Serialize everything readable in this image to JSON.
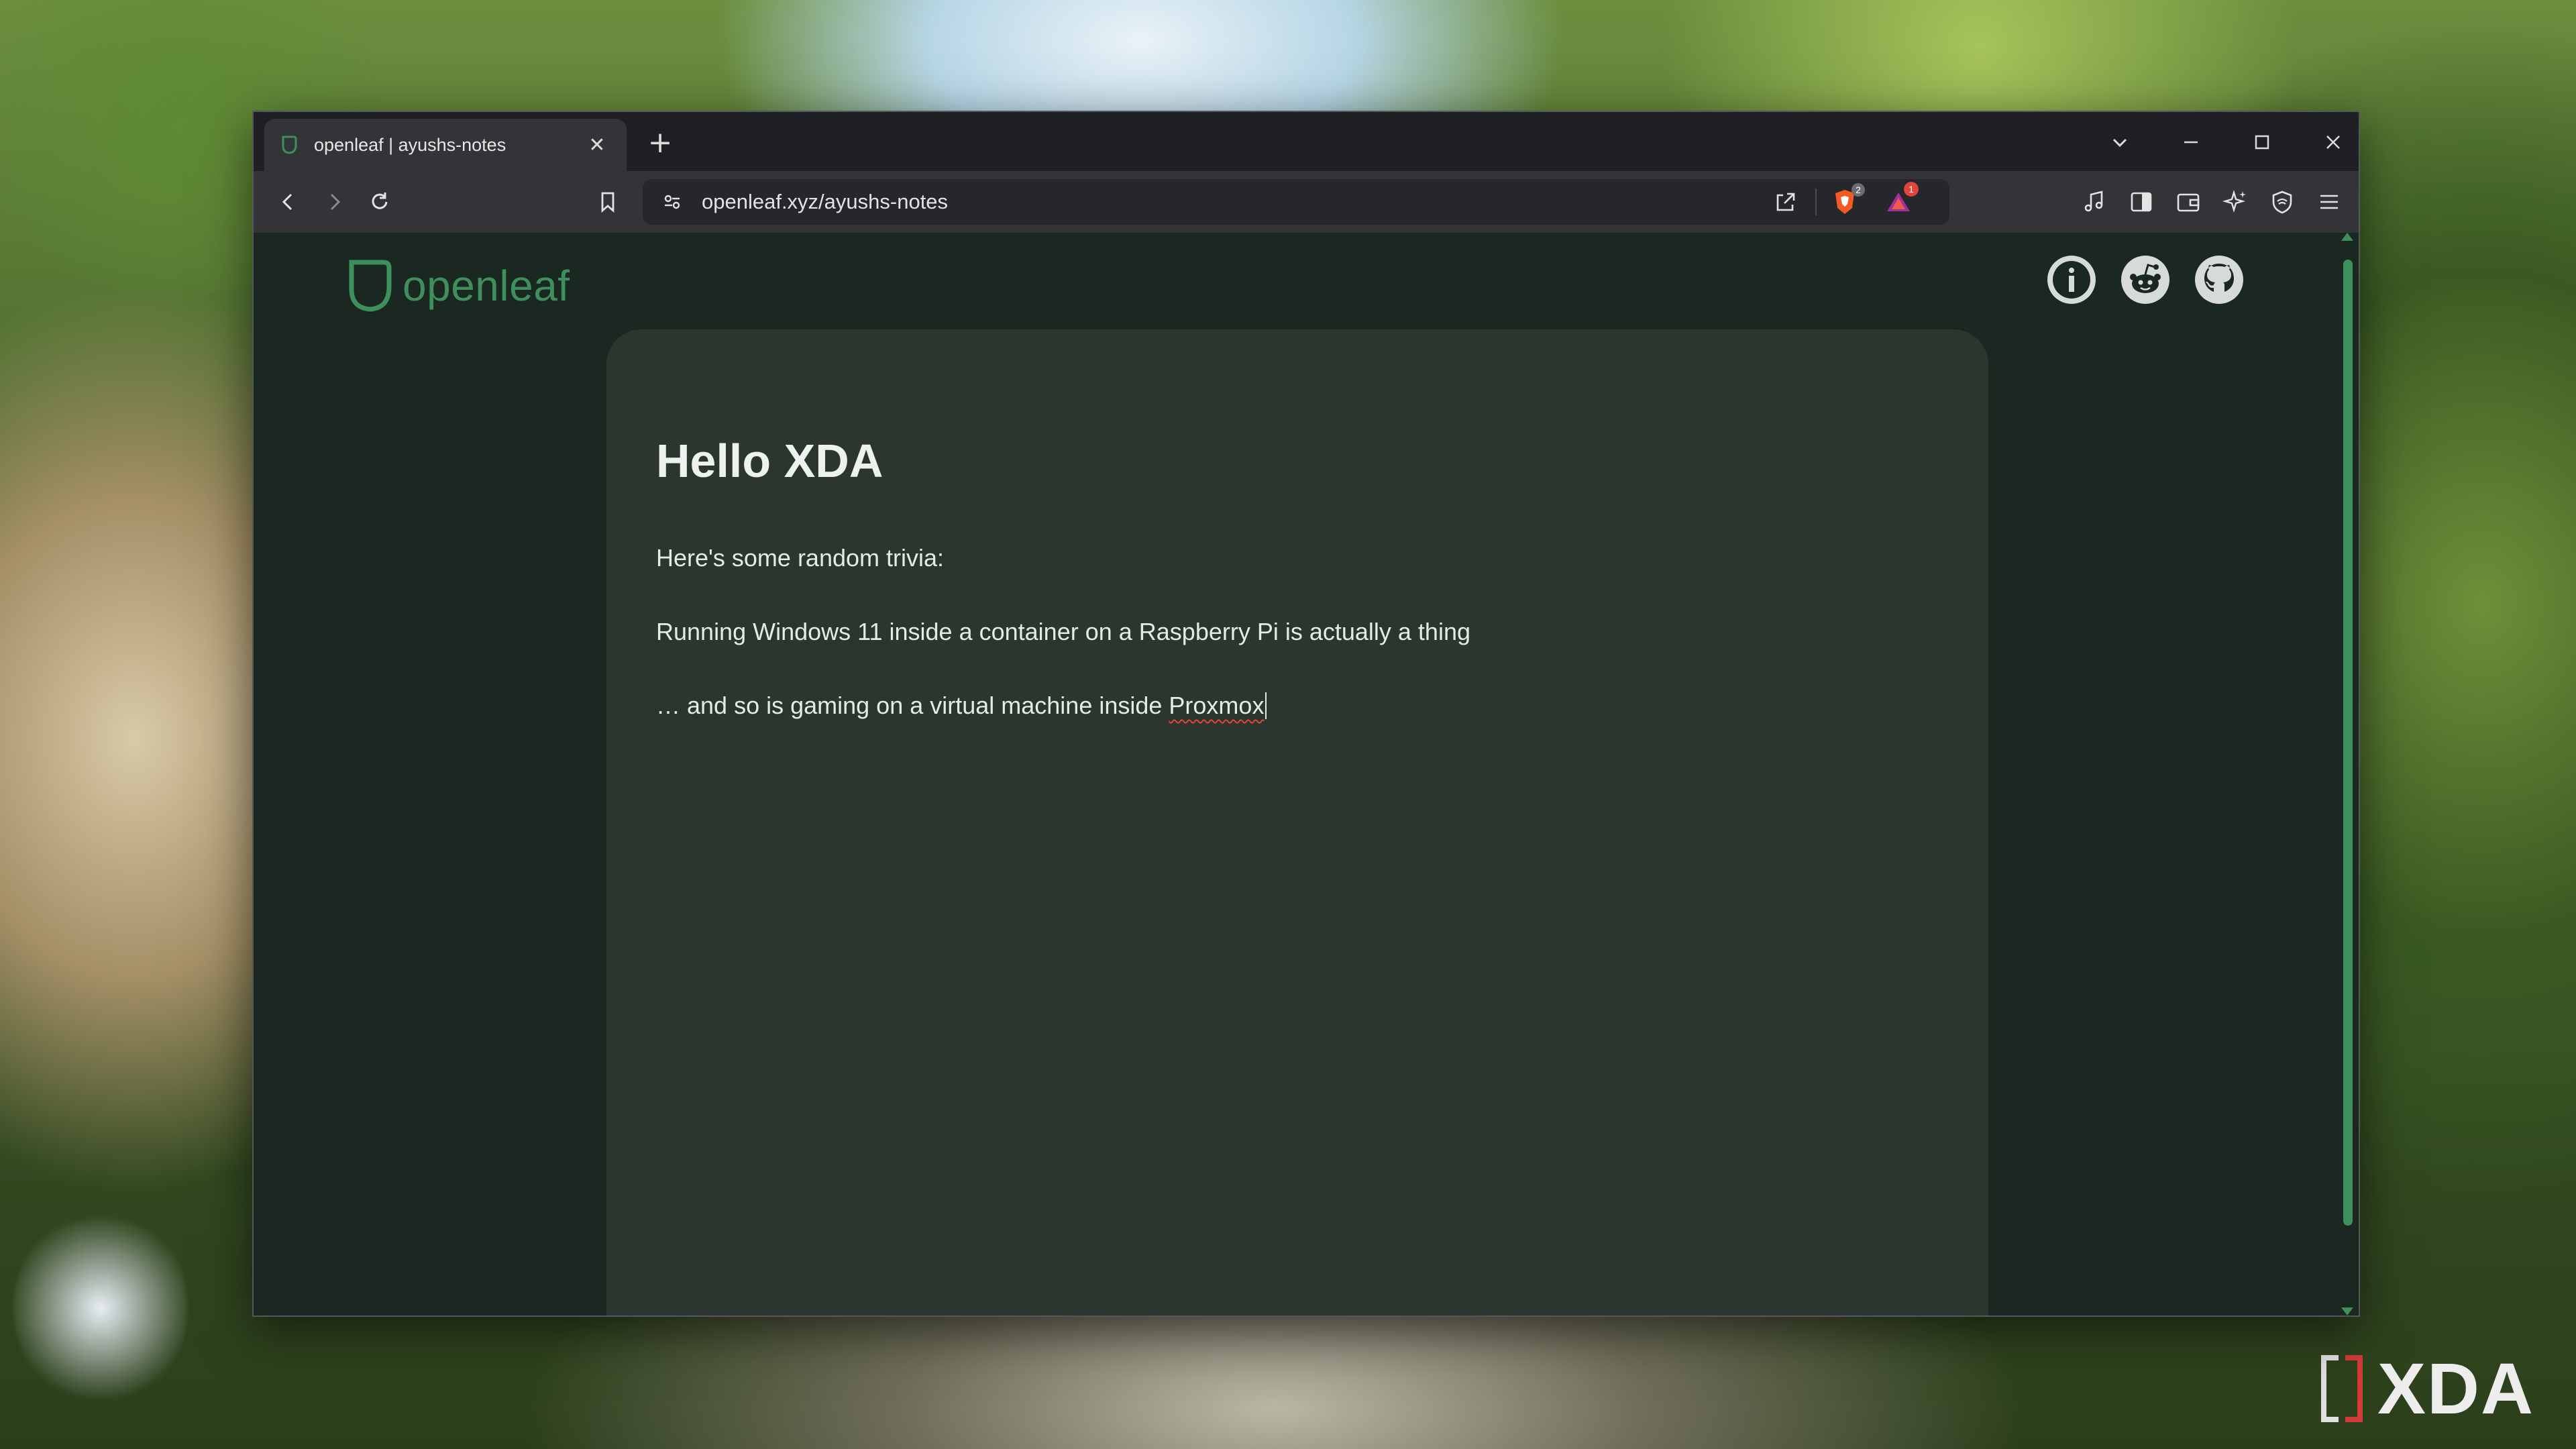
{
  "browser": {
    "tab": {
      "title": "openleaf | ayushs-notes",
      "favicon": "openleaf-leaf-icon",
      "close_icon": "close-icon"
    },
    "new_tab_icon": "plus-icon",
    "window_controls": [
      "tab-search-chevron-icon",
      "minimize-icon",
      "maximize-icon",
      "close-icon"
    ],
    "nav": [
      "back-icon",
      "forward-icon",
      "reload-icon",
      "bookmark-icon"
    ],
    "address": {
      "text": "openleaf.xyz/ayushs-notes",
      "site_info_icon": "site-settings-icon",
      "share_icon": "share-icon"
    },
    "shields": {
      "icon": "brave-shields-icon",
      "badge": "2"
    },
    "rewards": {
      "icon": "brave-rewards-icon",
      "badge": "1"
    },
    "toolbar_right": [
      "media-music-icon",
      "sidebar-icon",
      "wallet-icon",
      "leo-ai-icon",
      "vpn-icon",
      "menu-icon"
    ]
  },
  "page": {
    "logo_text": "openleaf",
    "social_icons": [
      "info-icon",
      "reddit-icon",
      "github-icon"
    ],
    "note": {
      "title": "Hello XDA",
      "line1": "Here's some random trivia:",
      "line2": "Running Windows 11 inside a container on a Raspberry Pi is actually a thing",
      "line3_prefix": "… and so is gaming on a virtual machine inside ",
      "line3_misspelled": "Proxmox"
    }
  },
  "watermark": {
    "text": "XDA"
  },
  "colors": {
    "accent": "#3f8f5c",
    "page_bg": "#1b2721",
    "card_bg": "#2b362e",
    "browser_chrome": "#333438",
    "tabstrip": "#1f2023"
  }
}
